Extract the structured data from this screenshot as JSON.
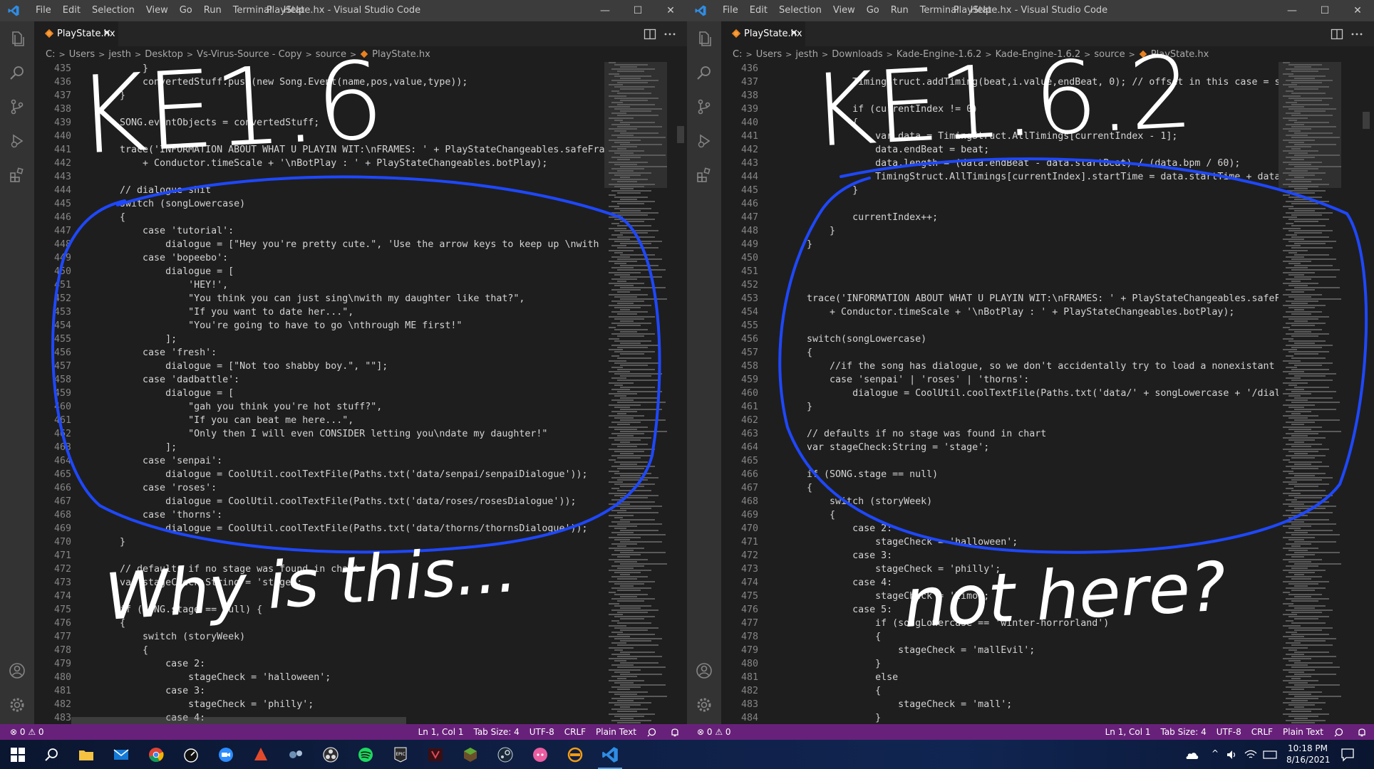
{
  "left": {
    "menus": [
      "File",
      "Edit",
      "Selection",
      "View",
      "Go",
      "Run",
      "Terminal",
      "Help"
    ],
    "window_title": "PlayState.hx - Visual Studio Code",
    "controls": {
      "minimize": "—",
      "maximize": "☐",
      "close": "✕"
    },
    "tab": {
      "label": "PlayState.hx",
      "close": "✕"
    },
    "breadcrumb": [
      "C:",
      "Users",
      "jesth",
      "Desktop",
      "Vs-Virus-Source - Copy",
      "source",
      "PlayState.hx"
    ],
    "line_numbers": [
      "435",
      "436",
      "437",
      "438",
      "439",
      "440",
      "441",
      "442",
      "443",
      "444",
      "445",
      "446",
      "447",
      "448",
      "449",
      "450",
      "451",
      "452",
      "453",
      "454",
      "455",
      "456",
      "457",
      "458",
      "459",
      "460",
      "461",
      "462",
      "463",
      "464",
      "465",
      "466",
      "467",
      "468",
      "469",
      "470",
      "471",
      "472",
      "473",
      "474",
      "475",
      "476",
      "477",
      "478",
      "479",
      "480",
      "481",
      "482",
      "483"
    ],
    "code_lines": [
      "        }",
      "        convertedStuff.push(new Song.Event(name,pos,value,type));",
      "    }",
      "",
      "    SONG.eventObjects = convertedStuff;",
      "",
      "    trace('INFORMATION ABOUT WHAT U PLAYIN WIT:\\nFRAMES: ' + PlayStateChangeables.safeFrames + '\\nZONE: ' + Conductor.safeZoneOffset + '\\nTS: '",
      "        + Conductor.timeScale + '\\nBotPlay : ' + PlayStateChangeables.botPlay);",
      "",
      "    // dialogue shit",
      "    switch (songLowercase)",
      "    {",
      "        case 'tutorial':",
      "            dialogue = [\"Hey you're pretty cute.\", 'Use the arrow keys to keep up \\nwith me singing.'];",
      "        case 'bopeebo':",
      "            dialogue = [",
      "                'HEY!',",
      "                \"You think you can just sing\\nwith my daughter like that?\",",
      "                \"If you want to date her...\",",
      "                \"You're going to have to go \\nthrough ME first!\"",
      "            ];",
      "        case 'fresh':",
      "            dialogue = [\"Not too shabby boy.\", \"\"];",
      "        case 'dadbattle':",
      "            dialogue = [",
      "                \"gah you think you're hot stuff?\",",
      "                \"If you can beat me here...\",",
      "                \"Only then I will even CONSIDER letting you\\ndate my daughter!\"",
      "            ];",
      "        case 'senpai':",
      "            dialogue = CoolUtil.coolTextFile(Paths.txt('data/senpai/senpaiDialogue'));",
      "        case 'roses':",
      "            dialogue = CoolUtil.coolTextFile(Paths.txt('data/roses/rosesDialogue'));",
      "        case 'thorns':",
      "            dialogue = CoolUtil.coolTextFile(Paths.txt('data/thorns/thornsDialogue'));",
      "    }",
      "",
      "    // defaults if no stage was found in chart",
      "    var stageCheck:String = 'stage';",
      "",
      "    if (SONG.stage == null) {",
      "    {",
      "        switch (storyWeek)",
      "        {",
      "            case 2:",
      "                stageCheck = 'halloween';",
      "            case 3:",
      "                stageCheck = 'philly';",
      "            case 4:"
    ],
    "status": {
      "problems": "⊗ 0 ⚠ 0",
      "position": "Ln 1, Col 1",
      "tab_size": "Tab Size: 4",
      "encoding": "UTF-8",
      "eol": "CRLF",
      "language": "Plain Text"
    }
  },
  "right": {
    "menus": [
      "File",
      "Edit",
      "Selection",
      "View",
      "Go",
      "Run",
      "Terminal",
      "Help"
    ],
    "window_title": "PlayState.hx - Visual Studio Code",
    "controls": {
      "minimize": "—",
      "maximize": "☐",
      "close": "✕"
    },
    "tab": {
      "label": "PlayState.hx",
      "close": "✕"
    },
    "breadcrumb": [
      "C:",
      "Users",
      "jesth",
      "Downloads",
      "Kade-Engine-1.6.2",
      "Kade-Engine-1.6.2",
      "source",
      "PlayState.hx"
    ],
    "line_numbers": [
      "436",
      "437",
      "438",
      "439",
      "440",
      "441",
      "442",
      "443",
      "444",
      "445",
      "446",
      "447",
      "448",
      "449",
      "450",
      "451",
      "452",
      "453",
      "454",
      "455",
      "456",
      "457",
      "458",
      "459",
      "460",
      "461",
      "462",
      "463",
      "464",
      "465",
      "466",
      "467",
      "468",
      "469",
      "470",
      "471",
      "472",
      "473",
      "474",
      "475",
      "476",
      "477",
      "478",
      "479",
      "480",
      "481",
      "482",
      "483",
      "484"
    ],
    "code_lines": [
      "",
      "            TimingStruct.addTiming(beat,i.value,endBeat, 0); // offset in this case = start time since we don't have a offset",
      "",
      "            if (currentIndex != 0)",
      "            {",
      "                var data = TimingStruct.AllTimings[currentIndex - 1];",
      "                data.endBeat = beat;",
      "                data.length = (data.endBeat - data.startBeat) / (data.bpm / 60);",
      "                TimingStruct.AllTimings[currentIndex].startTime = data.startTime + data.length;",
      "            }",
      "",
      "            currentIndex++;",
      "        }",
      "    }",
      "",
      "",
      "",
      "    trace('INFORMATION ABOUT WHAT U PLAYIN WIT:\\nFRAMES: ' + PlayStateChangeables.safeFrames + '\\nZONE: '",
      "        + Conductor.timeScale + '\\nBotPlay : ' + PlayStateChangeables.botPlay);",
      "",
      "    switch(songLowercase)",
      "    {",
      "        //if the song has dialogue, so we don't accidentally try to load a nonexistant file and crash the game",
      "        case 'senpai' | 'roses' | 'thorns':",
      "            dialogue = CoolUtil.coolTextFile(Paths.txt('data/' + songLowercase + '/dialogue'));",
      "    }",
      "",
      "    // defaults if no stage was found in chart",
      "    var stageCheck:String = 'stage';",
      "",
      "    if (SONG.stage == null)",
      "    {",
      "        switch (storyWeek)",
      "        {",
      "            case 2:",
      "                stageCheck = 'halloween';",
      "            case 3:",
      "                stageCheck = 'philly';",
      "            case 4:",
      "                stageCheck = 'limo';",
      "            case 5:",
      "                if (songLowercase == 'winter-horrorland')",
      "                {",
      "                    stageCheck = 'mallEvil';",
      "                }",
      "                else",
      "                {",
      "                    stageCheck = 'mall';",
      "                }"
    ],
    "status": {
      "problems": "⊗ 0 ⚠ 0",
      "position": "Ln 1, Col 1",
      "tab_size": "Tab Size: 4",
      "encoding": "UTF-8",
      "eol": "CRLF",
      "language": "Plain Text"
    }
  },
  "annotations": {
    "left_label": "KE1.6",
    "right_label": "KE1.6.2",
    "left_caption": "Why is this...",
    "right_caption": "not here?",
    "ink_color": "#1e48ff"
  },
  "taskbar": {
    "icons": [
      "windows-start-icon",
      "search-icon",
      "file-explorer-icon",
      "mail-icon",
      "chrome-icon",
      "speed-icon",
      "zoom-icon",
      "app-red-icon",
      "tools-icon",
      "obs-icon",
      "spotify-icon",
      "epic-games-icon",
      "game-icon",
      "minecraft-icon",
      "steam-icon",
      "discord-icon",
      "audio-icon",
      "vscode-icon"
    ],
    "time": "10:18 PM",
    "date": "8/16/2021"
  },
  "colors": {
    "status_bar": "#68217a",
    "editor_bg": "#1e1e1e",
    "title_bar": "#3c3c3c"
  }
}
